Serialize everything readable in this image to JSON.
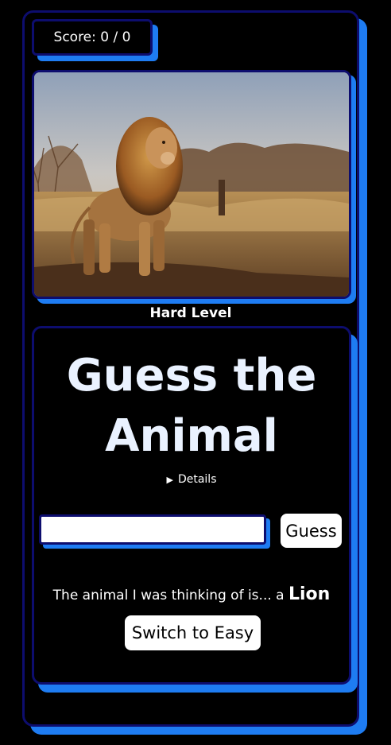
{
  "score": {
    "label": "Score: 0 / 0"
  },
  "image": {
    "subject_icon": "lion-photo"
  },
  "level": {
    "label": "Hard Level"
  },
  "game": {
    "title": "Guess the Animal",
    "details_label": "Details",
    "guess_input_value": "",
    "guess_button_label": "Guess",
    "reveal_prefix": "The animal I was thinking of is... a ",
    "reveal_answer": "Lion",
    "switch_button_label": "Switch to Easy"
  },
  "colors": {
    "accent": "#1e7cf2",
    "border": "#0d0d6e",
    "background": "#000000"
  }
}
